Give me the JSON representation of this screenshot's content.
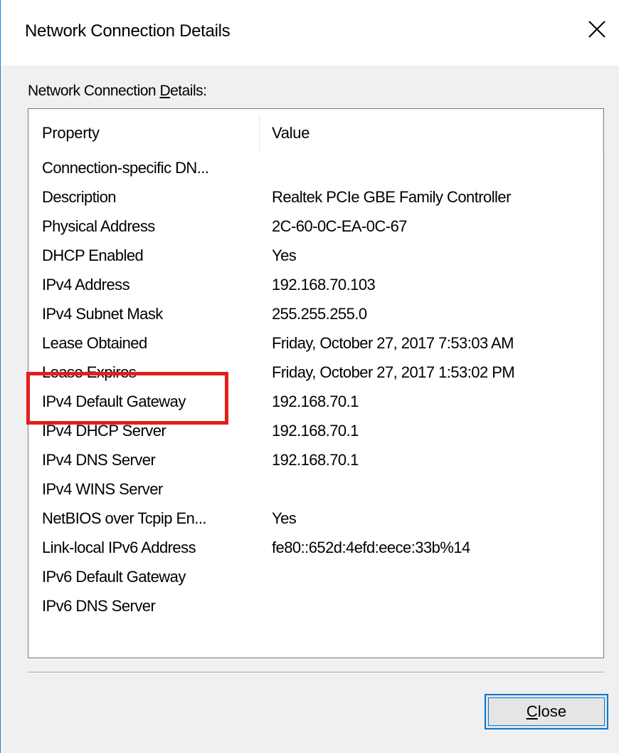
{
  "window": {
    "title": "Network Connection Details",
    "group_label_pre": "Network Connection ",
    "group_label_mnemonic": "D",
    "group_label_post": "etails:"
  },
  "columns": {
    "property": "Property",
    "value": "Value"
  },
  "rows": [
    {
      "property": "Connection-specific DN...",
      "value": ""
    },
    {
      "property": "Description",
      "value": "Realtek PCIe GBE Family Controller"
    },
    {
      "property": "Physical Address",
      "value": "2C-60-0C-EA-0C-67"
    },
    {
      "property": "DHCP Enabled",
      "value": "Yes"
    },
    {
      "property": "IPv4 Address",
      "value": "192.168.70.103"
    },
    {
      "property": "IPv4 Subnet Mask",
      "value": "255.255.255.0"
    },
    {
      "property": "Lease Obtained",
      "value": "Friday, October 27, 2017 7:53:03 AM"
    },
    {
      "property": "Lease Expires",
      "value": "Friday, October 27, 2017 1:53:02 PM"
    },
    {
      "property": "IPv4 Default Gateway",
      "value": "192.168.70.1"
    },
    {
      "property": "IPv4 DHCP Server",
      "value": "192.168.70.1"
    },
    {
      "property": "IPv4 DNS Server",
      "value": "192.168.70.1"
    },
    {
      "property": "IPv4 WINS Server",
      "value": ""
    },
    {
      "property": "NetBIOS over Tcpip En...",
      "value": "Yes"
    },
    {
      "property": "Link-local IPv6 Address",
      "value": "fe80::652d:4efd:eece:33b%14"
    },
    {
      "property": "IPv6 Default Gateway",
      "value": ""
    },
    {
      "property": "IPv6 DNS Server",
      "value": ""
    }
  ],
  "buttons": {
    "close_mnemonic": "C",
    "close_rest": "lose"
  },
  "icons": {
    "title_close": "close-icon"
  },
  "colors": {
    "highlight_box": "#e0201b",
    "focus_border": "#0078d7",
    "window_border": "#1883d7"
  }
}
